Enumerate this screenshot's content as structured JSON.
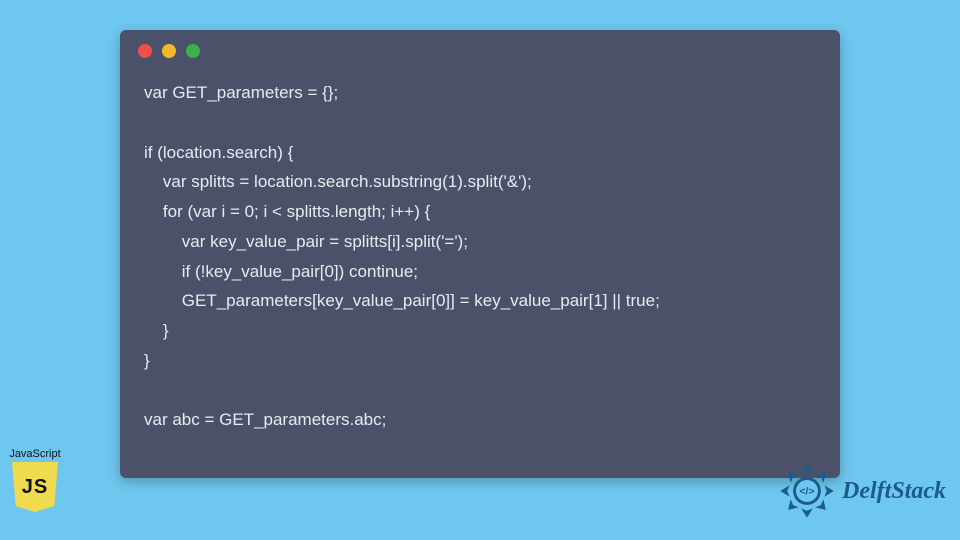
{
  "code": {
    "lines": [
      "var GET_parameters = {};",
      "",
      "if (location.search) {",
      "    var splitts = location.search.substring(1).split('&');",
      "    for (var i = 0; i < splitts.length; i++) {",
      "        var key_value_pair = splitts[i].split('=');",
      "        if (!key_value_pair[0]) continue;",
      "        GET_parameters[key_value_pair[0]] = key_value_pair[1] || true;",
      "    }",
      "}",
      "",
      "var abc = GET_parameters.abc;"
    ]
  },
  "js_badge": {
    "label": "JavaScript",
    "short": "JS"
  },
  "brand": {
    "name": "DelftStack"
  },
  "window": {
    "dots": [
      "red",
      "yellow",
      "green"
    ]
  }
}
